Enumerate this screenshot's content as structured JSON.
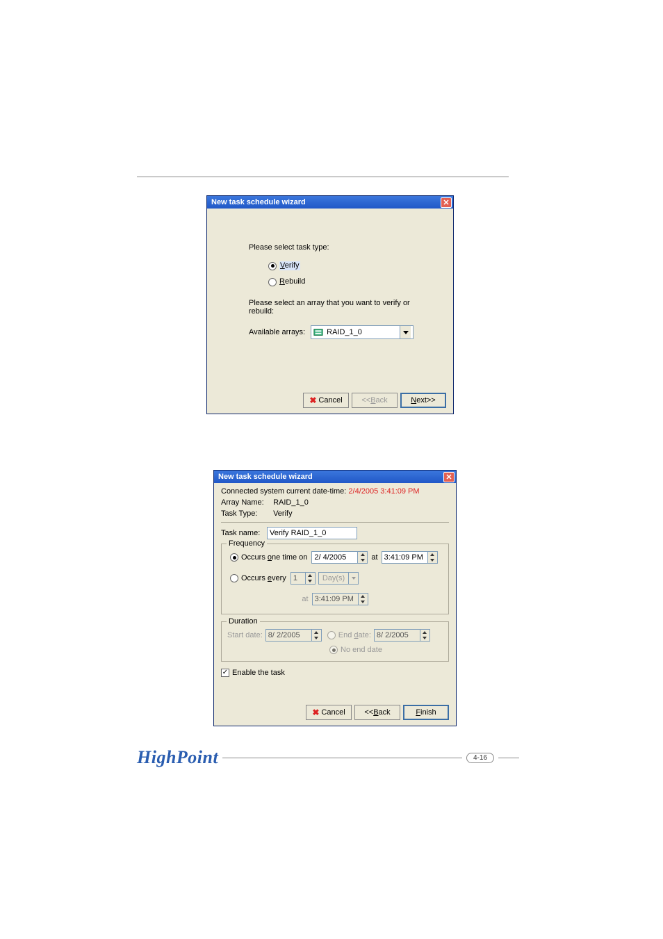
{
  "dialog1": {
    "title": "New task schedule wizard",
    "select_task_type_label": "Please select task type:",
    "verify_label_u": "V",
    "verify_label_rest": "erify",
    "rebuild_label_u": "R",
    "rebuild_label_rest": "ebuild",
    "select_array_label": "Please select an array that you want to verify or rebuild:",
    "available_arrays_label": "Available arrays:",
    "selected_array": "RAID_1_0",
    "cancel_label": "Cancel",
    "back_pre": "<<",
    "back_u": "B",
    "back_rest": "ack",
    "next_u": "N",
    "next_rest": "ext>>"
  },
  "dialog2": {
    "title": "New task schedule wizard",
    "datetime_label": "Connected system current date-time:",
    "datetime_value": "2/4/2005 3:41:09 PM",
    "array_name_label": "Array Name:",
    "array_name_value": "RAID_1_0",
    "task_type_label": "Task Type:",
    "task_type_value": "Verify",
    "task_name_label": "Task name:",
    "task_name_value": "Verify RAID_1_0",
    "frequency_group": "Frequency",
    "occurs_one_pre": "Occurs ",
    "occurs_one_u": "o",
    "occurs_one_rest": "ne time on",
    "occurs_one_date": "2/ 4/2005",
    "at_label": "at",
    "occurs_one_time": "3:41:09 PM",
    "occurs_every_pre": "Occurs ",
    "occurs_every_u": "e",
    "occurs_every_rest": "very",
    "occurs_every_value": "1",
    "occurs_every_unit": "Day(s)",
    "occurs_every_time": "3:41:09 PM",
    "duration_group": "Duration",
    "start_date_label": "Start date:",
    "start_date_value": "8/ 2/2005",
    "end_date_pre": "End ",
    "end_date_u": "d",
    "end_date_rest": "ate:",
    "end_date_value": "8/ 2/2005",
    "no_end_date_label": "No end date",
    "enable_task_label": "Enable the task",
    "cancel_label": "Cancel",
    "back_pre": "<<",
    "back_u": "B",
    "back_rest": "ack",
    "finish_u": "F",
    "finish_rest": "inish"
  },
  "footer": {
    "logo": "HighPoint",
    "page": "4-16"
  }
}
